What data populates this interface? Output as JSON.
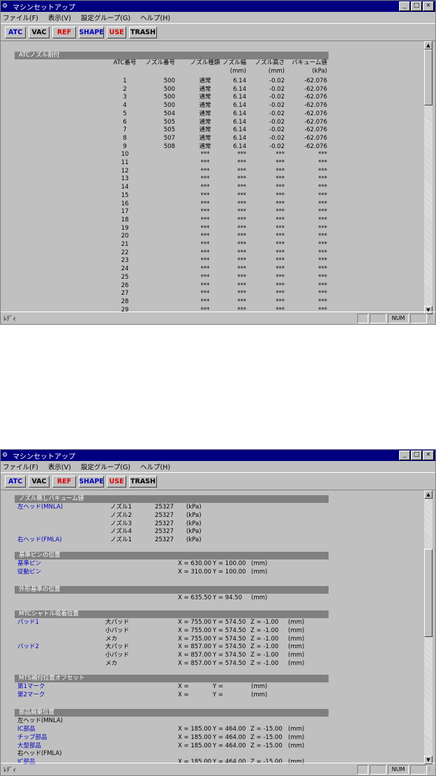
{
  "app": {
    "title": "マシンセットアップ",
    "icon": "app-icon",
    "menus": [
      "ファイル(F)",
      "表示(V)",
      "設定グループ(G)",
      "ヘルプ(H)"
    ],
    "window_buttons": [
      "_",
      "□",
      "×"
    ],
    "toolbar": [
      {
        "label": "ATC",
        "color": "#0000c0"
      },
      {
        "label": "VAC",
        "color": "#000000"
      },
      {
        "label": "REF",
        "color": "#e00000"
      },
      {
        "label": "SHAPE",
        "color": "#0000c0"
      },
      {
        "label": "USE",
        "color": "#e00000"
      },
      {
        "label": "TRASH",
        "color": "#000000"
      }
    ],
    "status": {
      "text": "ﾚﾃﾞｨ",
      "num": "NUM"
    }
  },
  "window1": {
    "section": "ATCノズル割付",
    "headers": [
      "ATC番号",
      "ノズル番号",
      "ノズル種類",
      "ノズル幅",
      "ノズル高さ",
      "バキューム値"
    ],
    "units": [
      "(mm)",
      "(mm)",
      "(kPa)"
    ],
    "rows": [
      [
        "1",
        "500",
        "通常",
        "6.14",
        "-0.02",
        "-62.076"
      ],
      [
        "2",
        "500",
        "通常",
        "6.14",
        "-0.02",
        "-62.076"
      ],
      [
        "3",
        "500",
        "通常",
        "6.14",
        "-0.02",
        "-62.076"
      ],
      [
        "4",
        "500",
        "通常",
        "6.14",
        "-0.02",
        "-62.076"
      ],
      [
        "5",
        "504",
        "通常",
        "6.14",
        "-0.02",
        "-62.076"
      ],
      [
        "6",
        "505",
        "通常",
        "6.14",
        "-0.02",
        "-62.076"
      ],
      [
        "7",
        "505",
        "通常",
        "6.14",
        "-0.02",
        "-62.076"
      ],
      [
        "8",
        "507",
        "通常",
        "6.14",
        "-0.02",
        "-62.076"
      ],
      [
        "9",
        "508",
        "通常",
        "6.14",
        "-0.02",
        "-62.076"
      ],
      [
        "10",
        "",
        "***",
        "***",
        "***",
        "***"
      ],
      [
        "11",
        "",
        "***",
        "***",
        "***",
        "***"
      ],
      [
        "12",
        "",
        "***",
        "***",
        "***",
        "***"
      ],
      [
        "13",
        "",
        "***",
        "***",
        "***",
        "***"
      ],
      [
        "14",
        "",
        "***",
        "***",
        "***",
        "***"
      ],
      [
        "15",
        "",
        "***",
        "***",
        "***",
        "***"
      ],
      [
        "16",
        "",
        "***",
        "***",
        "***",
        "***"
      ],
      [
        "17",
        "",
        "***",
        "***",
        "***",
        "***"
      ],
      [
        "18",
        "",
        "***",
        "***",
        "***",
        "***"
      ],
      [
        "19",
        "",
        "***",
        "***",
        "***",
        "***"
      ],
      [
        "20",
        "",
        "***",
        "***",
        "***",
        "***"
      ],
      [
        "21",
        "",
        "***",
        "***",
        "***",
        "***"
      ],
      [
        "22",
        "",
        "***",
        "***",
        "***",
        "***"
      ],
      [
        "23",
        "",
        "***",
        "***",
        "***",
        "***"
      ],
      [
        "24",
        "",
        "***",
        "***",
        "***",
        "***"
      ],
      [
        "25",
        "",
        "***",
        "***",
        "***",
        "***"
      ],
      [
        "26",
        "",
        "***",
        "***",
        "***",
        "***"
      ],
      [
        "27",
        "",
        "***",
        "***",
        "***",
        "***"
      ],
      [
        "28",
        "",
        "***",
        "***",
        "***",
        "***"
      ],
      [
        "29",
        "",
        "***",
        "***",
        "***",
        "***"
      ]
    ]
  },
  "window2": {
    "vac": {
      "section": "ノズル無しバキューム値",
      "left_head": "左ヘッド(MNLA)",
      "right_head": "右ヘッド(FMLA)",
      "rows": [
        {
          "nozzle": "ノズル1",
          "value": "25327",
          "unit": "(kPa)"
        },
        {
          "nozzle": "ノズル2",
          "value": "25327",
          "unit": "(kPa)"
        },
        {
          "nozzle": "ノズル3",
          "value": "25327",
          "unit": "(kPa)"
        },
        {
          "nozzle": "ノズル4",
          "value": "25327",
          "unit": "(kPa)"
        },
        {
          "nozzle": "ノズル1",
          "value": "25327",
          "unit": "(kPa)"
        }
      ]
    },
    "ref_pin": {
      "section": "基準ピンの位置",
      "rows": [
        {
          "label": "基準ピン",
          "x": "X = 630.00",
          "y": "Y = 100.00",
          "unit": "(mm)"
        },
        {
          "label": "従動ピン",
          "x": "X = 310.00",
          "y": "Y = 100.00",
          "unit": "(mm)"
        }
      ]
    },
    "outline": {
      "section": "外形基準の位置",
      "x": "X = 635.50",
      "y": "Y =   94.50",
      "unit": "(mm)"
    },
    "mtc": {
      "section": "MTCシャトル吸着位置",
      "pads": [
        {
          "label": "パッド1",
          "rows": [
            {
              "name": "大パッド",
              "x": "X = 755.00",
              "y": "Y = 574.50",
              "z": "Z =  -1.00",
              "unit": "(mm)"
            },
            {
              "name": "小パッド",
              "x": "X = 755.00",
              "y": "Y = 574.50",
              "z": "Z =  -1.00",
              "unit": "(mm)"
            },
            {
              "name": "メカ",
              "x": "X = 755.00",
              "y": "Y = 574.50",
              "z": "Z =  -1.00",
              "unit": "(mm)"
            }
          ]
        },
        {
          "label": "パッド2",
          "rows": [
            {
              "name": "大パッド",
              "x": "X = 857.00",
              "y": "Y = 574.50",
              "z": "Z =  -1.00",
              "unit": "(mm)"
            },
            {
              "name": "小パッド",
              "x": "X = 857.00",
              "y": "Y = 574.50",
              "z": "Z =  -1.00",
              "unit": "(mm)"
            },
            {
              "name": "メカ",
              "x": "X = 857.00",
              "y": "Y = 574.50",
              "z": "Z =  -1.00",
              "unit": "(mm)"
            }
          ]
        }
      ]
    },
    "mts": {
      "section": "MTS補付位置オフセット",
      "rows": [
        {
          "label": "第1マーク",
          "x": "X =",
          "y": "Y =",
          "unit": "(mm)"
        },
        {
          "label": "第2マーク",
          "x": "X =",
          "y": "Y =",
          "unit": "(mm)"
        }
      ]
    },
    "discard": {
      "section": "部品廃棄位置",
      "left_head": "左ヘッド(MNLA)",
      "right_head": "右ヘッド(FMLA)",
      "rows": [
        {
          "label": "IC部品",
          "x": "X = 185.00",
          "y": "Y = 464.00",
          "z": "Z = -15.00",
          "unit": "(mm)"
        },
        {
          "label": "チップ部品",
          "x": "X = 185.00",
          "y": "Y = 464.00",
          "z": "Z = -15.00",
          "unit": "(mm)"
        },
        {
          "label": "大型部品",
          "x": "X = 185.00",
          "y": "Y = 464.00",
          "z": "Z = -15.00",
          "unit": "(mm)"
        },
        {
          "label": "IC部品",
          "x": "X = 185.00",
          "y": "Y = 464.00",
          "z": "Z = -15.00",
          "unit": "(mm)"
        }
      ]
    }
  }
}
